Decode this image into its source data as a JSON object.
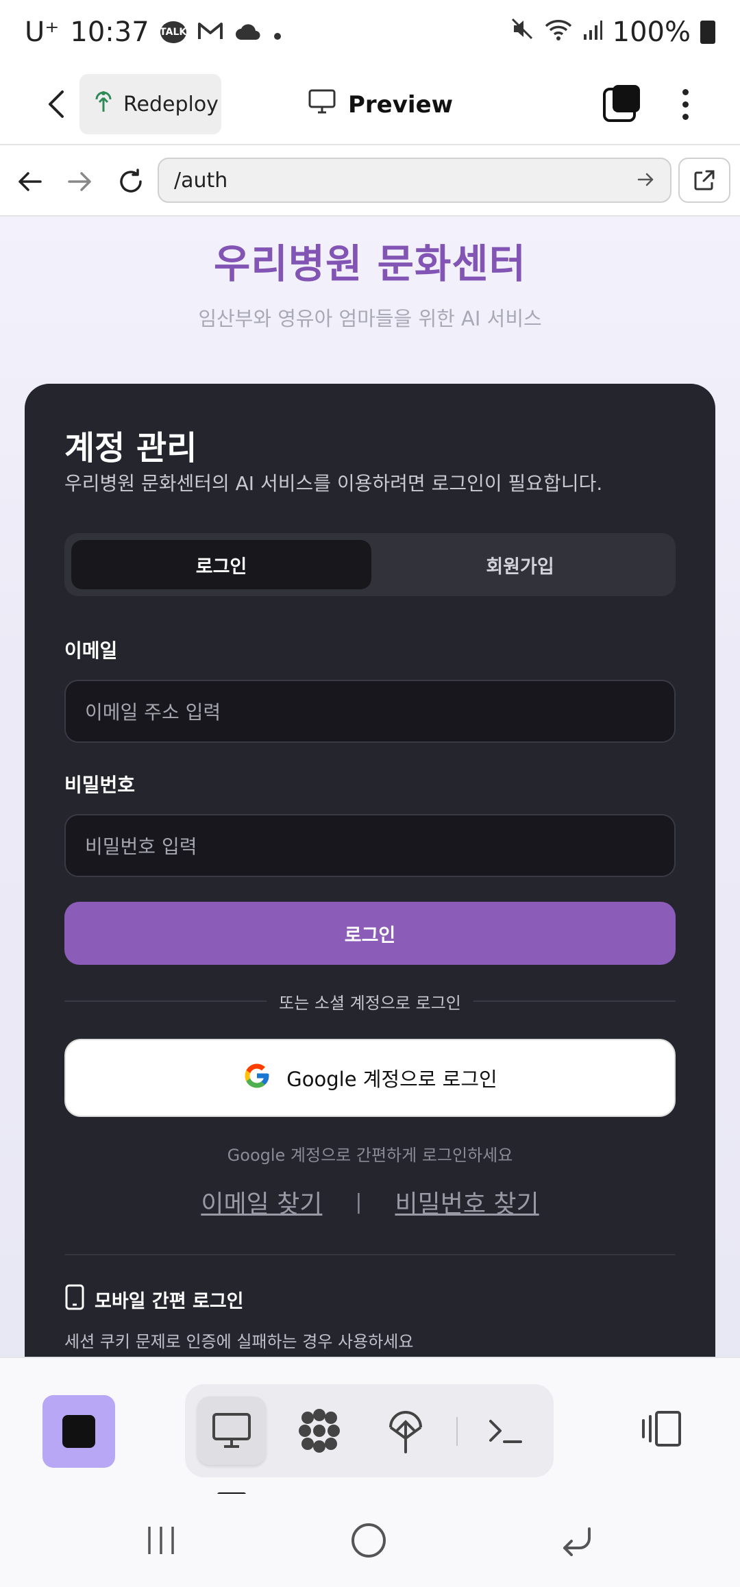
{
  "status_bar": {
    "carrier": "U⁺",
    "time": "10:37",
    "talk_badge": "TALK",
    "battery": "100%"
  },
  "app_bar": {
    "redeploy_label": "Redeploy",
    "preview_label": "Preview"
  },
  "browser": {
    "url": "/auth"
  },
  "page": {
    "title": "우리병원 문화센터",
    "subtitle": "임산부와 영유아 엄마들을 위한 AI 서비스"
  },
  "card": {
    "title": "계정 관리",
    "description": "우리병원 문화센터의 AI 서비스를 이용하려면 로그인이 필요합니다.",
    "tabs": [
      {
        "label": "로그인",
        "active": true
      },
      {
        "label": "회원가입",
        "active": false
      }
    ],
    "email_label": "이메일",
    "email_placeholder": "이메일 주소 입력",
    "password_label": "비밀번호",
    "password_placeholder": "비밀번호 입력",
    "login_button": "로그인",
    "social_divider": "또는 소셜 계정으로 로그인",
    "google_button": "Google 계정으로 로그인",
    "google_hint": "Google 계정으로 간편하게 로그인하세요",
    "find_email": "이메일 찾기",
    "separator": "|",
    "find_password": "비밀번호 찾기",
    "mobile_title": "모바일 간편 로그인",
    "mobile_desc": "세션 쿠키 문제로 인증에 실패하는 경우 사용하세요"
  },
  "colors": {
    "accent": "#8c5cb9",
    "title_purple": "#8255b5",
    "card_bg": "#25252d",
    "stop_button": "#b8a7f5"
  },
  "icons": {
    "status": [
      "talk-icon",
      "gmail-icon",
      "cloud-icon",
      "mute-icon",
      "wifi-icon",
      "signal-icon",
      "battery-icon"
    ],
    "toolbar": [
      "preview-icon",
      "apps-icon",
      "deploy-icon",
      "terminal-icon",
      "layout-icon"
    ]
  }
}
